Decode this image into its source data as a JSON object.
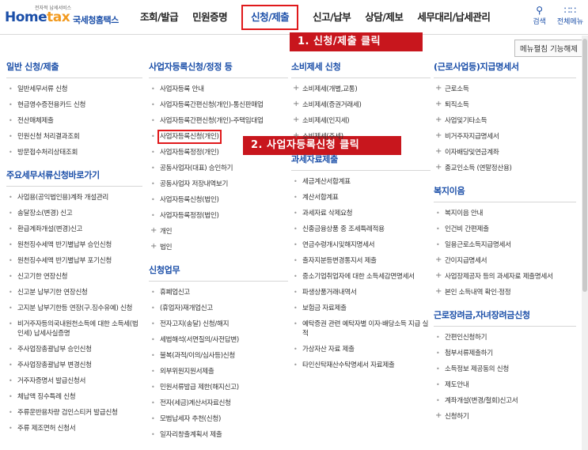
{
  "logo": {
    "tagline": "전자적 납세서비스",
    "brand_main": "Home",
    "brand_tax": "tax",
    "korean": "국세청홈택스"
  },
  "gnb": [
    "조회/발급",
    "민원증명",
    "신청/제출",
    "신고/납부",
    "상담/제보",
    "세무대리/납세관리"
  ],
  "gnb_active_index": 2,
  "top_icons": [
    {
      "icon": "search-icon",
      "label": "검색"
    },
    {
      "icon": "grid-menu-icon",
      "label": "전체메뉴"
    }
  ],
  "help_button": "메뉴펼침 기능해제",
  "callouts": {
    "step1": "1. 신청/제출 클릭",
    "step2": "2. 사업자등록신청 클릭"
  },
  "columns": [
    {
      "sections": [
        {
          "title": "일반 신청/제출",
          "items": [
            "일반세무서류 신청",
            "현금영수증전용카드 신청",
            "전산매체제출",
            "민원신청 처리결과조회",
            "방문접수처리상태조회"
          ]
        },
        {
          "title": "주요세무서류신청바로가기",
          "items": [
            "사업용(공익법인용)계좌 개설관리",
            "송달장소(변경) 신고",
            "환급계좌개설(변경)신고",
            "원천징수세액 반기별납부 승인신청",
            "원천징수세액 반기별납부 포기신청",
            "신고기한 연장신청",
            "신고분 납부기한 연장신청",
            "고지분 납부기한등 연장(구.징수유예) 신청",
            "비거주자등의국내원천소득에 대한 소득세(법인세) 납세사실증명",
            "주사업장총괄납부 승인신청",
            "주사업장총괄납부 변경신청",
            "거주자증명서 발급신청서",
            "체납액 징수특례 신청",
            "주류운반용차량 검인스티커 발급신청",
            "주류 제조면허 신청서"
          ]
        }
      ]
    },
    {
      "sections": [
        {
          "title": "사업자등록신청/정정 등",
          "items": [
            "사업자등록 안내",
            "사업자등록간편신청(개인)-통신판매업",
            "사업자등록간편신청(개인)-주택임대업",
            "사업자등록신청(개인)",
            "사업자등록정정(개인)",
            "공동사업자(대표) 승인하기",
            "공동사업자 저장내역보기",
            "사업자등록신청(법인)",
            "사업자등록정정(법인)",
            "개인",
            "법인"
          ],
          "plus_items": [
            9,
            10
          ],
          "highlight_index": 3
        },
        {
          "title": "신청업무",
          "items": [
            "휴폐업신고",
            "(휴업자)재개업신고",
            "전자고지(송달) 신청/해지",
            "세법해석(서면질의/사전답변)",
            "불복(과적/이의/심사등)신청",
            "외부위원지원서제출",
            "민원서류발급 제한(해지신고)",
            "전자(세금)계산서자료신청",
            "모범납세자 추천(신청)",
            "일자리창출계획서 제출"
          ]
        }
      ]
    },
    {
      "sections": [
        {
          "title": "소비제세 신청",
          "items": [
            "소비제세(개별,교통)",
            "소비제세(증권거래세)",
            "소비제세(인지세)",
            "소비제세(주세)"
          ],
          "plus_items": [
            0,
            1,
            2,
            3
          ]
        },
        {
          "title": "과세자료제출",
          "items": [
            "세금계산서합계표",
            "계산서합계표",
            "과세자료 삭제요청",
            "신종금융상품 중 조세특례적용",
            "연금수령개시및해지명세서",
            "출자지분등변경통지서 제출",
            "중소기업취업자에 대한 소득세감면명세서",
            "파생상품거래내역서",
            "보험금 자료제출",
            "예탁증권 관련 예탁자별 이자·배당소득 지급 실적",
            "가상자산 자료 제출",
            "타인신탁재산수탁명세서 자료제출"
          ]
        }
      ]
    },
    {
      "sections": [
        {
          "title": "(근로사업등)지급명세서",
          "items": [
            "근로소득",
            "퇴직소득",
            "사업및기타소득",
            "비거주자지급명세서",
            "이자배당및연금계좌",
            "종교인소득 (연말정산용)"
          ],
          "plus_items": [
            0,
            1,
            2,
            3,
            4,
            5
          ]
        },
        {
          "title": "복지이음",
          "items": [
            "복지이음 안내",
            "인건비 간편제출",
            "일용근로소득지급명세서",
            "간이지급명세서",
            "사업장제공자 등의 과세자료 제출명세서",
            "본인 소득내역 확인·정정"
          ],
          "plus_items": [
            3,
            4,
            5
          ]
        },
        {
          "title": "근로장려금,자녀장려금신청",
          "items": [
            "간편인신청하기",
            "첨부서류제출하기",
            "소득정보 제공동의 신청",
            "제도안내",
            "계좌개설(변경/철회)신고서",
            "신청하기"
          ],
          "plus_items": [
            5
          ]
        }
      ]
    }
  ]
}
